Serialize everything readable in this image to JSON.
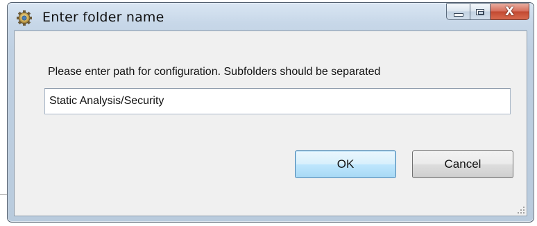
{
  "window": {
    "title": "Enter folder name",
    "app_icon": "gear-icon",
    "controls": {
      "minimize_icon": "minimize-icon",
      "maximize_icon": "maximize-icon",
      "close_label": "X"
    }
  },
  "dialog": {
    "prompt": "Please enter path for configuration. Subfolders should be separated",
    "path_input": {
      "value": "Static Analysis/Security",
      "placeholder": ""
    },
    "ok_label": "OK",
    "cancel_label": "Cancel"
  },
  "colors": {
    "frame": "#c7d7e8",
    "close_button": "#c24a32",
    "ok_focus_border": "#3c7fb1",
    "client_bg": "#f0f0f0"
  }
}
